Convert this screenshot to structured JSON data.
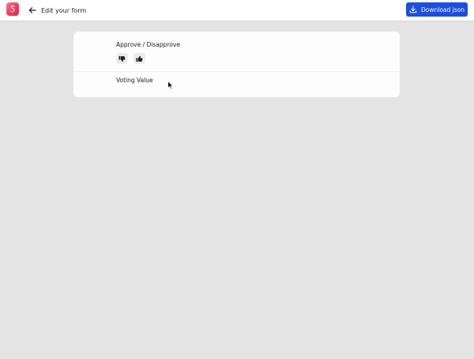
{
  "header": {
    "back_label": "Edit your form",
    "download_label": "Download json",
    "logo_icon": "survey-logo-icon",
    "back_icon": "arrow-left-icon",
    "download_icon": "download-icon"
  },
  "form": {
    "questions": [
      {
        "title": "Approve / Disapprove",
        "type": "voting",
        "options": [
          {
            "icon": "thumbs-down-icon"
          },
          {
            "icon": "thumbs-up-icon"
          }
        ]
      },
      {
        "title": "Voting Value"
      }
    ]
  },
  "colors": {
    "page_background": "#e4e4e4",
    "accent": "#1b4fe0",
    "logo": "#f2385f",
    "card_background": "#fdfdfd"
  }
}
